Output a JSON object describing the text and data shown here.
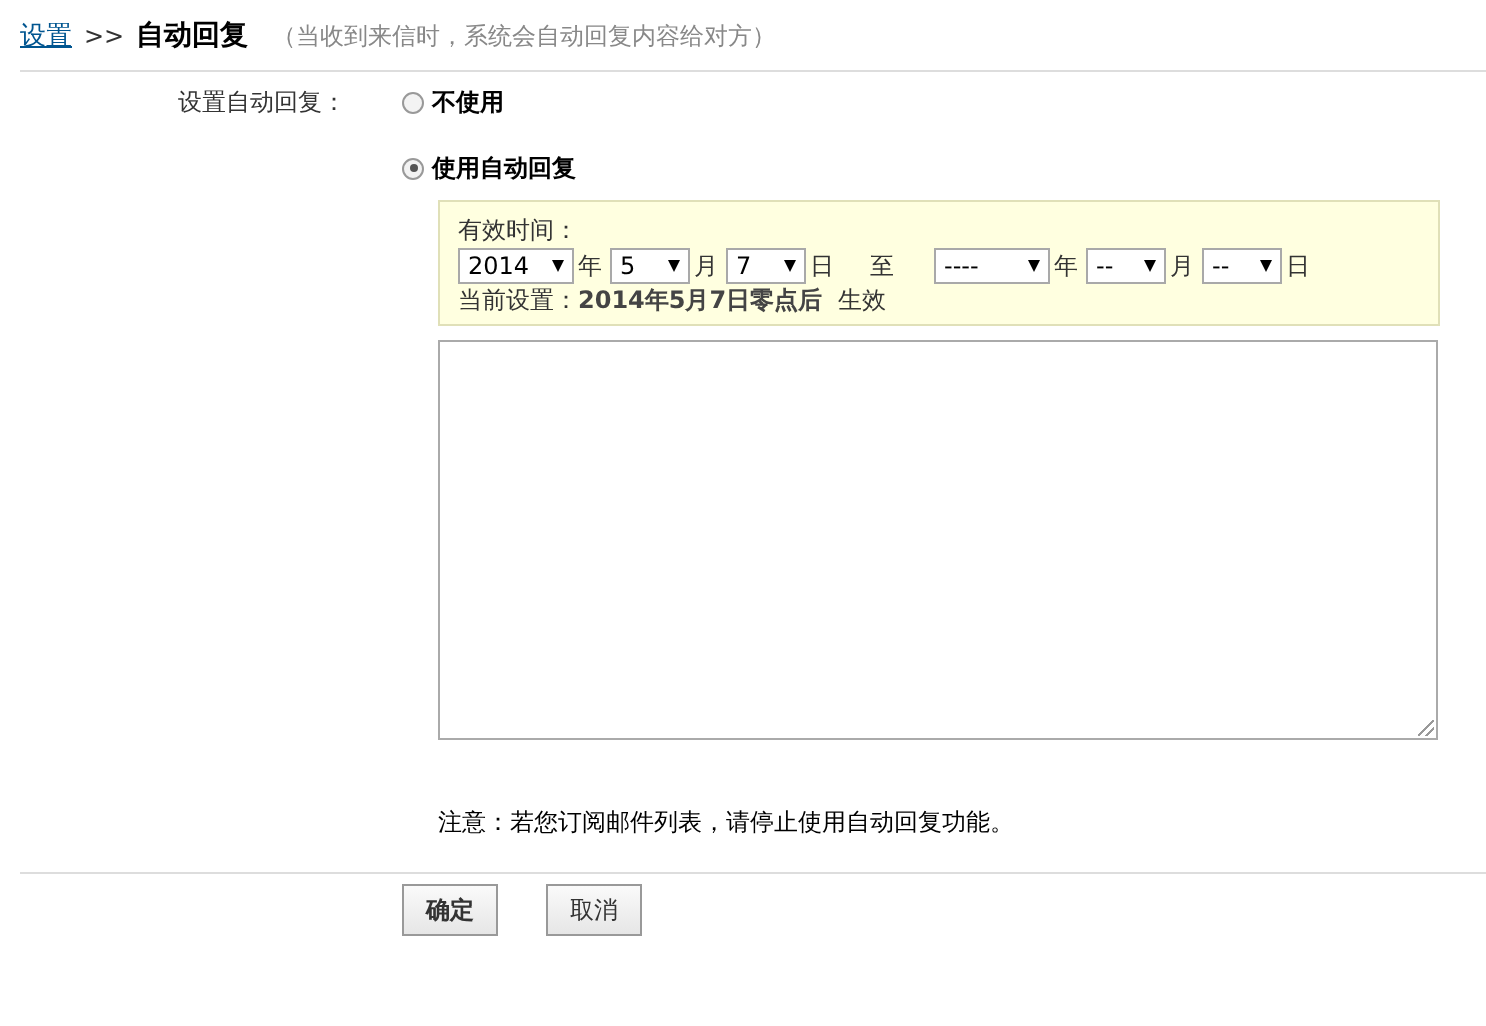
{
  "breadcrumb": {
    "link": "设置",
    "separator": ">>",
    "title": "自动回复",
    "hint": "（当收到来信时，系统会自动回复内容给对方）"
  },
  "setting_label": "设置自动回复：",
  "options": [
    {
      "label": "不使用",
      "selected": false
    },
    {
      "label": "使用自动回复",
      "selected": true
    }
  ],
  "validity": {
    "label": "有效时间：",
    "from": [
      {
        "value": "2014",
        "unit": "年",
        "kind": "year"
      },
      {
        "value": "5",
        "unit": "月",
        "kind": "short"
      },
      {
        "value": "7",
        "unit": "日",
        "kind": "short"
      }
    ],
    "separator": "至",
    "to": [
      {
        "value": "----",
        "unit": "年",
        "kind": "year"
      },
      {
        "value": "--",
        "unit": "月",
        "kind": "short"
      },
      {
        "value": "--",
        "unit": "日",
        "kind": "short"
      }
    ],
    "current_label": "当前设置：",
    "current_value": "2014年5月7日零点后",
    "status": "生效"
  },
  "note": "注意：若您订阅邮件列表，请停止使用自动回复功能。",
  "buttons": [
    {
      "label": "确定",
      "kind": "primary"
    },
    {
      "label": "取消",
      "kind": "secondary"
    }
  ]
}
